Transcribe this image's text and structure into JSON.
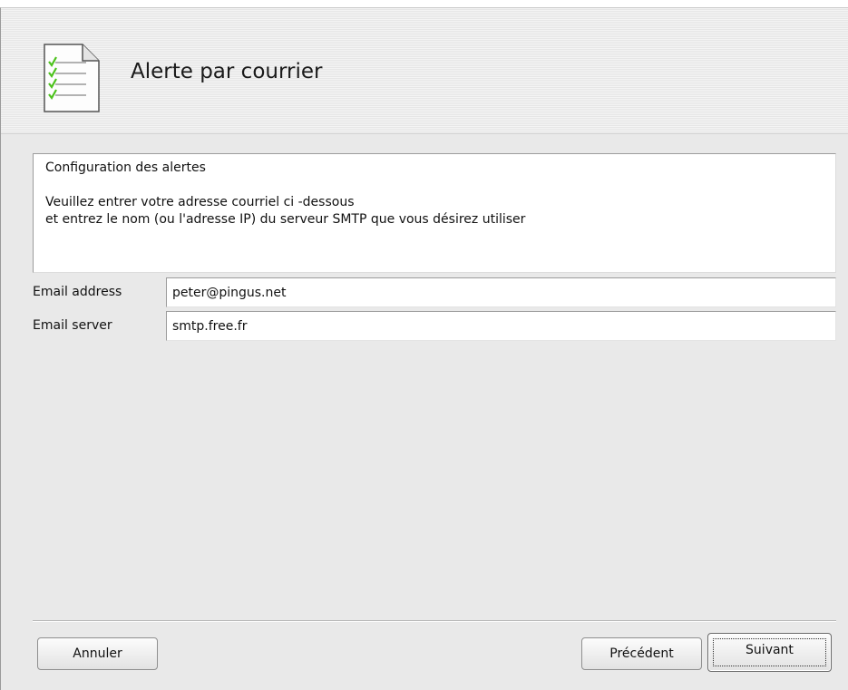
{
  "window": {
    "title": "Alerte par courrier",
    "icon": "checklist-document-icon"
  },
  "info": {
    "heading": "Configuration des alertes",
    "line1": "Veuillez entrer votre adresse courriel ci -dessous",
    "line2": "et entrez le nom (ou l'adresse IP) du serveur SMTP que vous désirez utiliser"
  },
  "fields": {
    "email_address": {
      "label": "Email address",
      "value": "peter@pingus.net"
    },
    "email_server": {
      "label": "Email server",
      "value": "smtp.free.fr"
    }
  },
  "buttons": {
    "cancel": "Annuler",
    "previous": "Précédent",
    "next": "Suivant"
  },
  "colors": {
    "window_background": "#e9e9e9",
    "check_green": "#4cc21c"
  }
}
